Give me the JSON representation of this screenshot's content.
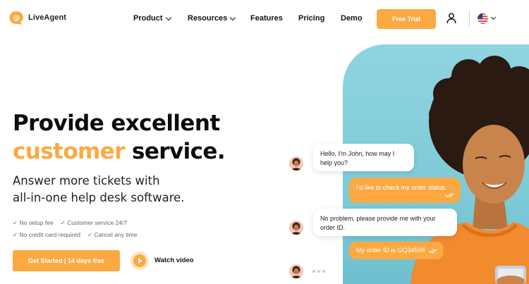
{
  "brand": {
    "name": "LiveAgent",
    "accent": "#fca942"
  },
  "nav": {
    "items": [
      {
        "label": "Product",
        "has_dropdown": true
      },
      {
        "label": "Resources",
        "has_dropdown": true
      },
      {
        "label": "Features",
        "has_dropdown": false
      },
      {
        "label": "Pricing",
        "has_dropdown": false
      },
      {
        "label": "Demo",
        "has_dropdown": false
      }
    ],
    "cta_label": "Free Trial",
    "icons": [
      "user-icon",
      "us-flag-icon",
      "chevron-down-icon"
    ]
  },
  "hero": {
    "headline_line1": "Provide excellent",
    "headline_accent": "customer",
    "headline_rest": " service.",
    "subtitle_line1": "Answer more tickets with",
    "subtitle_line2": "all-in-one help desk software.",
    "benefits": [
      "No setup fee",
      "Customer service 24/7",
      "No credit card required",
      "Cancel any time"
    ],
    "cta_label": "Get Started | 14 days free",
    "video_label": "Watch video"
  },
  "chat": {
    "messages": [
      {
        "from": "agent",
        "text": "Hello, I'm John, how may I help you?"
      },
      {
        "from": "user",
        "text": "I'd like to check my order status."
      },
      {
        "from": "agent",
        "text": "No problem, please provide me with your order ID."
      },
      {
        "from": "user",
        "text": "My order ID is GQ34566"
      }
    ]
  }
}
